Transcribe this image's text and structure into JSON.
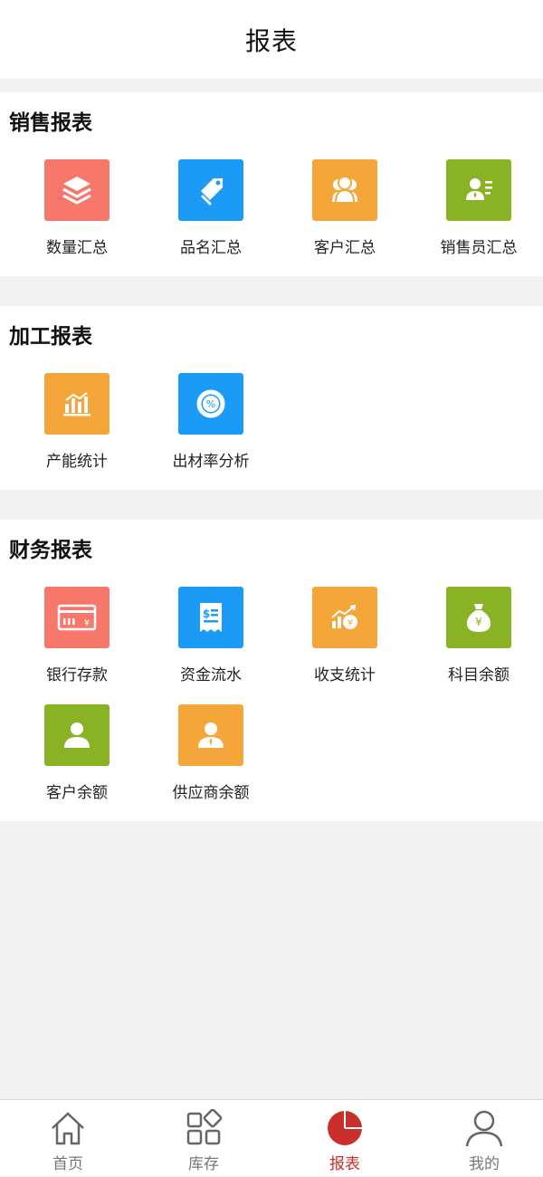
{
  "header": {
    "title": "报表"
  },
  "sections": {
    "sales": {
      "title": "销售报表",
      "items": [
        {
          "label": "数量汇总",
          "icon": "layers-icon",
          "color": "#f7776a"
        },
        {
          "label": "品名汇总",
          "icon": "tag-icon",
          "color": "#1b9bf5"
        },
        {
          "label": "客户汇总",
          "icon": "users-icon",
          "color": "#f4a63a"
        },
        {
          "label": "销售员汇总",
          "icon": "salesperson-icon",
          "color": "#89b324"
        }
      ]
    },
    "processing": {
      "title": "加工报表",
      "items": [
        {
          "label": "产能统计",
          "icon": "bar-chart-icon",
          "color": "#f4a63a"
        },
        {
          "label": "出材率分析",
          "icon": "percent-ring-icon",
          "color": "#1b9bf5"
        }
      ]
    },
    "finance": {
      "title": "财务报表",
      "items": [
        {
          "label": "银行存款",
          "icon": "bank-card-icon",
          "color": "#f7776a"
        },
        {
          "label": "资金流水",
          "icon": "receipt-icon",
          "color": "#1b9bf5"
        },
        {
          "label": "收支统计",
          "icon": "income-chart-icon",
          "color": "#f4a63a"
        },
        {
          "label": "科目余额",
          "icon": "money-bag-icon",
          "color": "#89b324"
        },
        {
          "label": "客户余额",
          "icon": "person-icon",
          "color": "#89b324"
        },
        {
          "label": "供应商余额",
          "icon": "supplier-icon",
          "color": "#f4a63a"
        }
      ]
    }
  },
  "tabbar": {
    "active_color": "#c9302c",
    "tabs": [
      {
        "label": "首页",
        "icon": "home-icon",
        "active": false
      },
      {
        "label": "库存",
        "icon": "inventory-icon",
        "active": false
      },
      {
        "label": "报表",
        "icon": "pie-chart-icon",
        "active": true
      },
      {
        "label": "我的",
        "icon": "profile-icon",
        "active": false
      }
    ]
  }
}
